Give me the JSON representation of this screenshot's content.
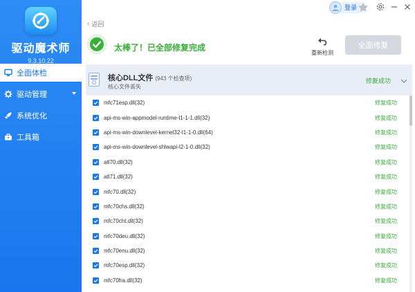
{
  "app": {
    "name": "驱动魔术师",
    "version": "9.3.10.22"
  },
  "sidebar": {
    "items": [
      {
        "label": "全面体检",
        "icon": "monitor-icon",
        "active": true
      },
      {
        "label": "驱动管理",
        "icon": "gear-icon",
        "has_submenu": true
      },
      {
        "label": "系统优化",
        "icon": "rocket-icon"
      },
      {
        "label": "工具箱",
        "icon": "toolbox-icon"
      }
    ]
  },
  "topbar": {
    "login_label": "登录"
  },
  "back_label": "返回",
  "header": {
    "success_text": "太棒了！已全部修复完成",
    "redetect_label": "重新检测",
    "repair_all_label": "全面修复"
  },
  "category": {
    "title": "核心DLL文件",
    "count_text": "(943 个检查项)",
    "subtitle": "核心文件丢失",
    "status": "修复成功"
  },
  "files": [
    {
      "name": "mfc71esp.dll(32)",
      "status": "修复成功"
    },
    {
      "name": "api-ms-win-appmodel-runtime-l1-1-1.dll(32)",
      "status": "修复成功"
    },
    {
      "name": "api-ms-win-downlevel-kernel32-l1-1-0.dll(64)",
      "status": "修复成功"
    },
    {
      "name": "api-ms-win-downlevel-shlwapi-l2-1-0.dll(32)",
      "status": "修复成功"
    },
    {
      "name": "atl70.dll(32)",
      "status": "修复成功"
    },
    {
      "name": "atl71.dll(32)",
      "status": "修复成功"
    },
    {
      "name": "mfc70.dll(32)",
      "status": "修复成功"
    },
    {
      "name": "mfc70chs.dll(32)",
      "status": "修复成功"
    },
    {
      "name": "mfc70cht.dll(32)",
      "status": "修复成功"
    },
    {
      "name": "mfc70deu.dll(32)",
      "status": "修复成功"
    },
    {
      "name": "mfc70enu.dll(32)",
      "status": "修复成功"
    },
    {
      "name": "mfc70esp.dll(32)",
      "status": "修复成功"
    },
    {
      "name": "mfc70fra.dll(32)",
      "status": "修复成功"
    }
  ],
  "colors": {
    "accent": "#1a76ee",
    "success": "#3cae3c",
    "disabled_button": "#d5d9df"
  }
}
